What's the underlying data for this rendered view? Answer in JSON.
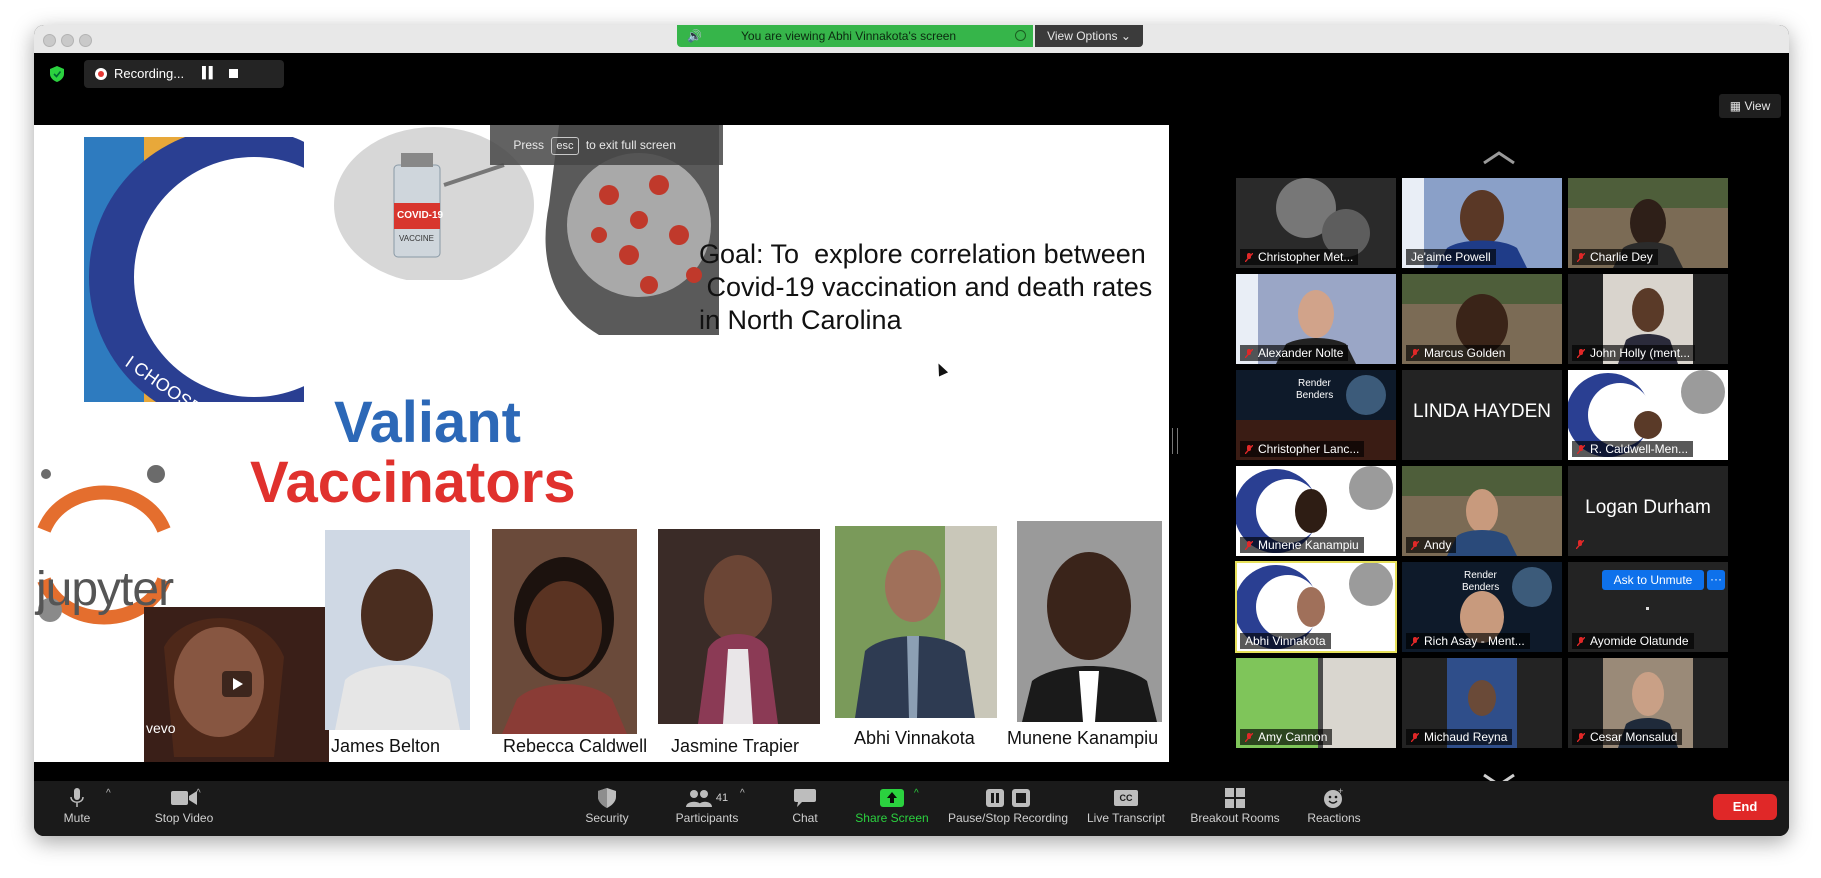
{
  "banner": {
    "text": "You are viewing Abhi Vinnakota's screen",
    "view_options": "View Options"
  },
  "recording": {
    "label": "Recording..."
  },
  "esc_hint": {
    "press": "Press",
    "key": "esc",
    "rest": "to exit full screen"
  },
  "view_button": {
    "label": "View"
  },
  "slide": {
    "goal_lines": [
      "Goal: To  explore correlation between",
      " Covid-19 vaccination and death rates",
      "in North Carolina"
    ],
    "brand_line1": "Valiant",
    "brand_line2": "Vaccinators",
    "jupyter": "jupyter",
    "vevo": "vevo",
    "vaccine_label": "COVID-19",
    "vaccine_sub": "VACCINE",
    "team": [
      "James Belton",
      "Rebecca Caldwell",
      "Jasmine Trapier",
      "Abhi Vinnakota",
      "Munene Kanampiu"
    ]
  },
  "gallery": {
    "tiles": [
      {
        "name": "Christopher Met..."
      },
      {
        "name": "Je'aime Powell"
      },
      {
        "name": "Charlie Dey"
      },
      {
        "name": "Alexander Nolte"
      },
      {
        "name": "Marcus Golden"
      },
      {
        "name": "John Holly (ment..."
      },
      {
        "name": "Christopher Lanc..."
      },
      {
        "name": "LINDA HAYDEN"
      },
      {
        "name": "R. Caldwell-Men..."
      },
      {
        "name": "Munene Kanampiu"
      },
      {
        "name": "Andy"
      },
      {
        "name": "Logan Durham"
      },
      {
        "name": "Abhi Vinnakota"
      },
      {
        "name": "Rich Asay - Ment..."
      },
      {
        "name": "Ayomide Olatunde"
      },
      {
        "name": "Amy Cannon"
      },
      {
        "name": "Michaud Reyna"
      },
      {
        "name": "Cesar Monsalud"
      }
    ],
    "render_benders": "Render\nBenders",
    "ask_to_unmute": "Ask to Unmute",
    "more": "···"
  },
  "toolbar": {
    "mute": "Mute",
    "stop_video": "Stop Video",
    "security": "Security",
    "participants": "Participants",
    "participant_count": "41",
    "chat": "Chat",
    "share_screen": "Share Screen",
    "pause_stop_recording": "Pause/Stop Recording",
    "live_transcript": "Live Transcript",
    "cc": "CC",
    "breakout_rooms": "Breakout Rooms",
    "reactions": "Reactions",
    "end": "End"
  },
  "colors": {
    "accent_green": "#36b54a",
    "end_red": "#e02828",
    "brand_blue": "#2c68b7",
    "brand_red": "#e0312d",
    "unmute_blue": "#0e71eb"
  }
}
